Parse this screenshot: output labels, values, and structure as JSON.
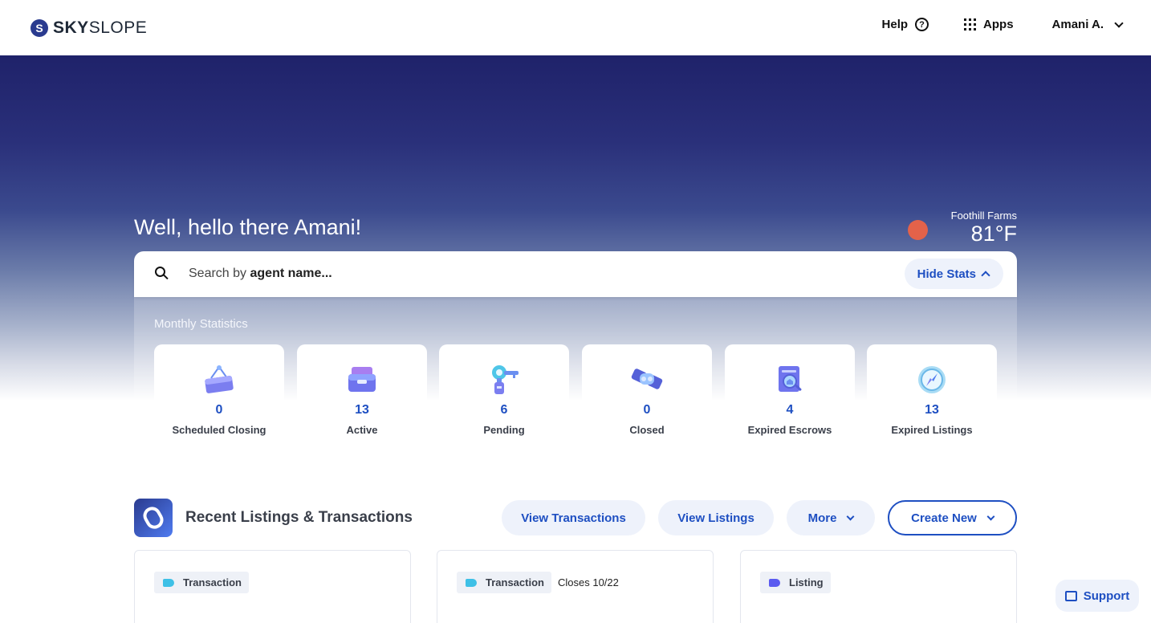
{
  "header": {
    "logo": {
      "text_bold": "SKY",
      "text_regular": "SLOPE",
      "mark": "S"
    },
    "help_label": "Help",
    "apps_label": "Apps",
    "user_label": "Amani A."
  },
  "hero": {
    "greeting": "Well, hello there Amani!",
    "weather": {
      "location": "Foothill Farms",
      "temperature": "81°F",
      "color": "#e3624a"
    }
  },
  "search": {
    "prefix": "Search by",
    "placeholder_bold": "agent name...",
    "hide_stats_label": "Hide Stats"
  },
  "stats": {
    "title": "Monthly Statistics",
    "items": [
      {
        "value": "0",
        "label": "Scheduled Closing",
        "icon": "hanging-sign-icon"
      },
      {
        "value": "13",
        "label": "Active",
        "icon": "mailbox-icon"
      },
      {
        "value": "6",
        "label": "Pending",
        "icon": "key-icon"
      },
      {
        "value": "0",
        "label": "Closed",
        "icon": "handshake-icon"
      },
      {
        "value": "4",
        "label": "Expired Escrows",
        "icon": "document-search-icon"
      },
      {
        "value": "13",
        "label": "Expired Listings",
        "icon": "compass-icon"
      }
    ]
  },
  "recent": {
    "title": "Recent Listings & Transactions",
    "buttons": {
      "view_transactions": "View Transactions",
      "view_listings": "View Listings",
      "more": "More",
      "create_new": "Create New"
    },
    "cards": [
      {
        "tag": "Transaction",
        "extra": "",
        "tag_color": "#3ec0e6"
      },
      {
        "tag": "Transaction",
        "extra": "Closes 10/22",
        "tag_color": "#3ec0e6"
      },
      {
        "tag": "Listing",
        "extra": "",
        "tag_color": "#5b5bf0"
      }
    ]
  },
  "support_label": "Support"
}
